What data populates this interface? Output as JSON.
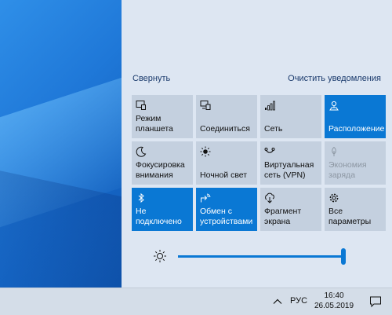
{
  "panel": {
    "collapse_label": "Свернуть",
    "clear_label": "Очистить уведомления"
  },
  "tiles": [
    {
      "label": "Режим\nпланшета",
      "icon": "tablet-mode-icon",
      "state": "off"
    },
    {
      "label": "Соединиться",
      "icon": "connect-icon",
      "state": "off"
    },
    {
      "label": "Сеть",
      "icon": "network-icon",
      "state": "off"
    },
    {
      "label": "Расположение",
      "icon": "location-icon",
      "state": "on"
    },
    {
      "label": "Фокусировка\nвнимания",
      "icon": "focus-assist-moon-icon",
      "state": "off"
    },
    {
      "label": "Ночной свет",
      "icon": "night-light-icon",
      "state": "off"
    },
    {
      "label": "Виртуальная\nсеть (VPN)",
      "icon": "vpn-icon",
      "state": "off"
    },
    {
      "label": "Экономия\nзаряда",
      "icon": "battery-saver-icon",
      "state": "disabled"
    },
    {
      "label": "Не\nподключено",
      "icon": "bluetooth-icon",
      "state": "on"
    },
    {
      "label": "Обмен с\nустройствами",
      "icon": "nearby-sharing-icon",
      "state": "on"
    },
    {
      "label": "Фрагмент\nэкрана",
      "icon": "screen-snip-icon",
      "state": "off"
    },
    {
      "label": "Все\nпараметры",
      "icon": "settings-gear-icon",
      "state": "off"
    }
  ],
  "brightness": {
    "level": 1.0,
    "icon": "brightness-sun-icon"
  },
  "taskbar": {
    "language": "РУС",
    "time": "16:40",
    "date": "26.05.2019"
  },
  "colors": {
    "accent": "#0a78d4",
    "tile_off": "#c4d0df",
    "panel_bg": "#dde6f2"
  }
}
